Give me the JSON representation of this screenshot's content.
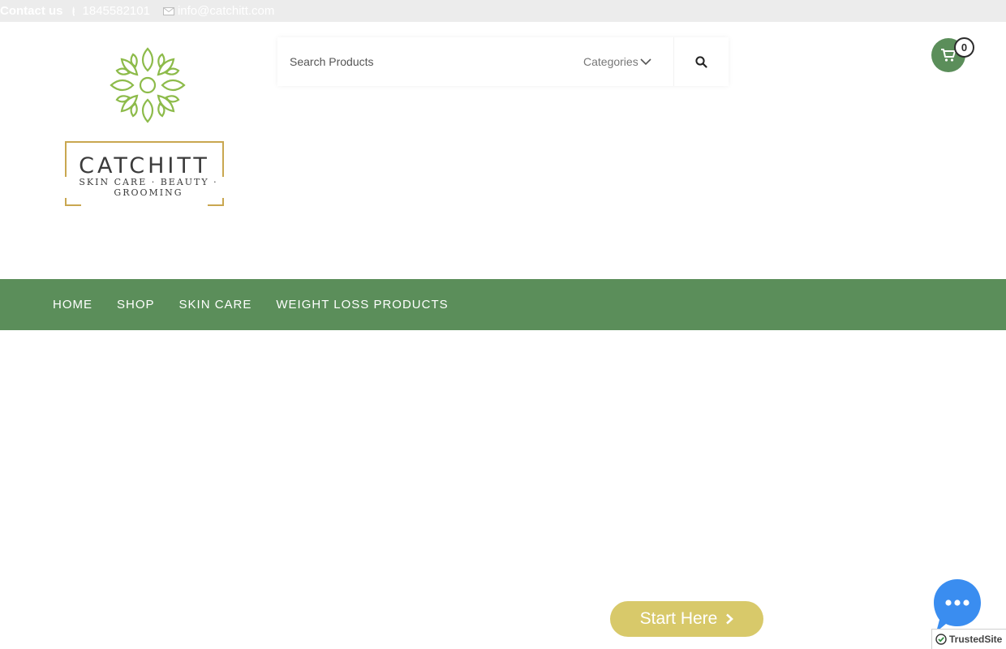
{
  "topbar": {
    "contact_label": "Contact us",
    "phone": "1845582101",
    "email": "info@catchitt.com"
  },
  "logo": {
    "brand_name": "CATCHITT",
    "tagline": "SKIN CARE · BEAUTY · GROOMING"
  },
  "search": {
    "placeholder": "Search Products",
    "categories_label": "Categories"
  },
  "cart": {
    "count": "0"
  },
  "nav": {
    "items": [
      {
        "label": "HOME"
      },
      {
        "label": "SHOP"
      },
      {
        "label": "SKIN CARE"
      },
      {
        "label": "WEIGHT LOSS PRODUCTS"
      }
    ]
  },
  "cta": {
    "start_label": "Start Here"
  },
  "badge": {
    "trusted_label": "TrustedSite"
  },
  "colors": {
    "brand_green": "#5b8e5a",
    "gold": "#c9a750",
    "cta_yellow": "#d8c96a",
    "chat_blue": "#3a8df0"
  },
  "icons": [
    "phone-icon",
    "mail-icon",
    "chevron-down-icon",
    "search-icon",
    "cart-icon",
    "chevron-right-icon",
    "chat-icon",
    "check-shield-icon"
  ]
}
